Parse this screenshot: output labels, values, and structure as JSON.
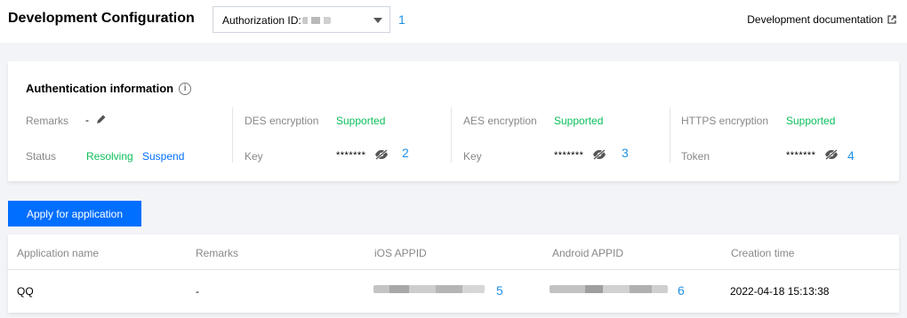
{
  "header": {
    "title": "Development Configuration",
    "auth_label": "Authorization ID:",
    "marker_1": "1",
    "doc_link": "Development documentation"
  },
  "auth_card": {
    "title": "Authentication information",
    "remarks_label": "Remarks",
    "remarks_value": "-",
    "status_label": "Status",
    "status_value": "Resolving",
    "suspend_link": "Suspend",
    "des_label": "DES encryption",
    "des_value": "Supported",
    "des_key_label": "Key",
    "des_key_value": "*******",
    "marker_2": "2",
    "aes_label": "AES encryption",
    "aes_value": "Supported",
    "aes_key_label": "Key",
    "aes_key_value": "*******",
    "marker_3": "3",
    "https_label": "HTTPS encryption",
    "https_value": "Supported",
    "token_label": "Token",
    "token_value": "*******",
    "marker_4": "4"
  },
  "apply_button": "Apply for application",
  "table": {
    "columns": [
      "Application name",
      "Remarks",
      "iOS APPID",
      "Android APPID",
      "Creation time"
    ],
    "rows": [
      {
        "name": "QQ",
        "remarks": "-",
        "marker_5": "5",
        "marker_6": "6",
        "created": "2022-04-18 15:13:38"
      }
    ]
  },
  "colors": {
    "accent": "#006eff",
    "success": "#0abf5b",
    "marker": "#1e90e6"
  }
}
